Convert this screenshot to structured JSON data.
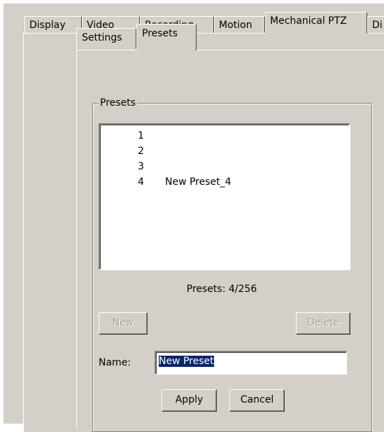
{
  "main_tabs": [
    {
      "label": "Display",
      "active": false
    },
    {
      "label": "Video",
      "active": false
    },
    {
      "label": "Recording",
      "active": false
    },
    {
      "label": "Motion",
      "active": false
    },
    {
      "label": "Mechanical PTZ",
      "active": true
    },
    {
      "label": "Di",
      "active": false
    }
  ],
  "sub_tabs": [
    {
      "label": "Settings",
      "active": false
    },
    {
      "label": "Presets",
      "active": true
    }
  ],
  "presets_group": {
    "title": "Presets",
    "items": [
      {
        "number": "1",
        "name": ""
      },
      {
        "number": "2",
        "name": ""
      },
      {
        "number": "3",
        "name": ""
      },
      {
        "number": "4",
        "name": "New Preset_4"
      }
    ],
    "count_label": "Presets:",
    "count_value": "4/256",
    "new_button": "New",
    "delete_button": "Delete",
    "name_label": "Name:",
    "name_value": "New Preset",
    "apply_button": "Apply",
    "cancel_button": "Cancel"
  },
  "colors": {
    "face": "#d4d0c8",
    "selection": "#0a246a"
  }
}
